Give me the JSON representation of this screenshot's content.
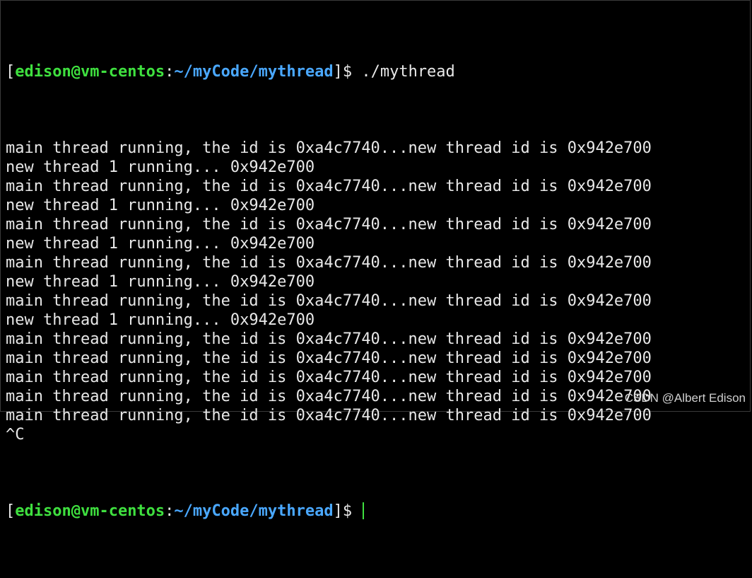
{
  "prompt": {
    "open_bracket": "[",
    "user_host": "edison@vm-centos",
    "colon": ":",
    "path": "~/myCode/mythread",
    "close_bracket": "]",
    "symbol": "$ "
  },
  "command": "./mythread",
  "output": [
    "main thread running, the id is 0xa4c7740...new thread id is 0x942e700",
    "new thread 1 running... 0x942e700",
    "main thread running, the id is 0xa4c7740...new thread id is 0x942e700",
    "new thread 1 running... 0x942e700",
    "main thread running, the id is 0xa4c7740...new thread id is 0x942e700",
    "new thread 1 running... 0x942e700",
    "main thread running, the id is 0xa4c7740...new thread id is 0x942e700",
    "new thread 1 running... 0x942e700",
    "main thread running, the id is 0xa4c7740...new thread id is 0x942e700",
    "new thread 1 running... 0x942e700",
    "main thread running, the id is 0xa4c7740...new thread id is 0x942e700",
    "main thread running, the id is 0xa4c7740...new thread id is 0x942e700",
    "main thread running, the id is 0xa4c7740...new thread id is 0x942e700",
    "main thread running, the id is 0xa4c7740...new thread id is 0x942e700",
    "main thread running, the id is 0xa4c7740...new thread id is 0x942e700",
    "^C"
  ],
  "watermark": "CSDN @Albert Edison",
  "colors": {
    "background": "#000000",
    "text": "#e8e8e8",
    "user_host": "#3fe03f",
    "path": "#4aa8ff",
    "cursor": "#3fe03f"
  }
}
